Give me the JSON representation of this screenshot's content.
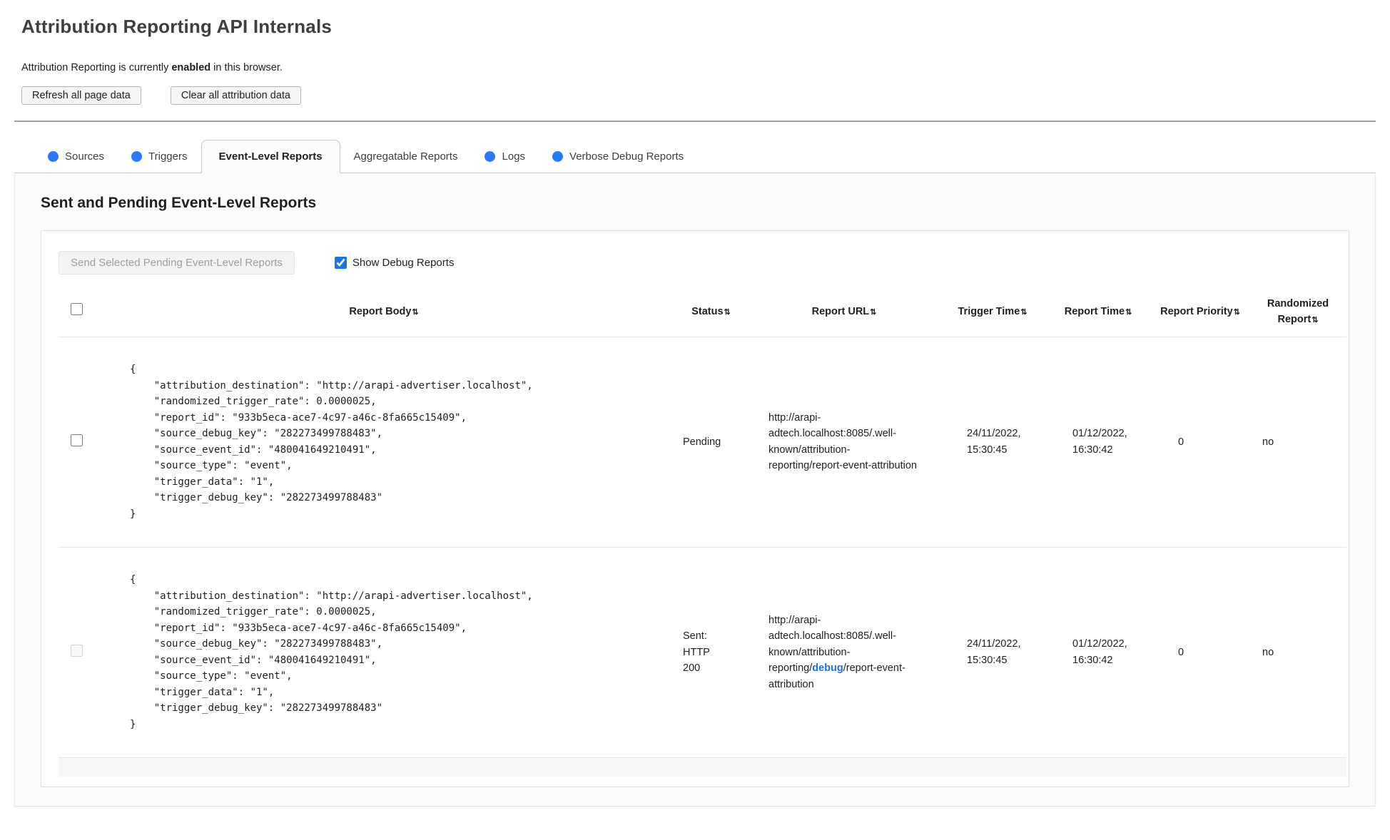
{
  "page": {
    "title": "Attribution Reporting API Internals",
    "status_prefix": "Attribution Reporting is currently ",
    "status_bold": "enabled",
    "status_suffix": " in this browser.",
    "refresh_button": "Refresh all page data",
    "clear_button": "Clear all attribution data"
  },
  "tabs": {
    "sources": "Sources",
    "triggers": "Triggers",
    "event_level": "Event-Level Reports",
    "aggregatable": "Aggregatable Reports",
    "logs": "Logs",
    "verbose": "Verbose Debug Reports"
  },
  "section": {
    "heading": "Sent and Pending Event-Level Reports",
    "send_button": "Send Selected Pending Event-Level Reports",
    "show_debug_label": "Show Debug Reports"
  },
  "table": {
    "sort_icon": "⇅",
    "columns": {
      "report_body": "Report Body",
      "status": "Status",
      "report_url": "Report URL",
      "trigger_time": "Trigger Time",
      "report_time": "Report Time",
      "report_priority": "Report Priority",
      "randomized_report": "Randomized Report"
    },
    "rows": [
      {
        "report_body": "{\n    \"attribution_destination\": \"http://arapi-advertiser.localhost\",\n    \"randomized_trigger_rate\": 0.0000025,\n    \"report_id\": \"933b5eca-ace7-4c97-a46c-8fa665c15409\",\n    \"source_debug_key\": \"282273499788483\",\n    \"source_event_id\": \"480041649210491\",\n    \"source_type\": \"event\",\n    \"trigger_data\": \"1\",\n    \"trigger_debug_key\": \"282273499788483\"\n}",
        "status": "Pending",
        "url_pre": "http://arapi-adtech.localhost:8085/.well-known/attribution-reporting/report-event-attribution",
        "url_link": "",
        "url_post": "",
        "trigger_time": "24/11/2022, 15:30:45",
        "report_time": "01/12/2022, 16:30:42",
        "priority": "0",
        "randomized": "no"
      },
      {
        "report_body": "{\n    \"attribution_destination\": \"http://arapi-advertiser.localhost\",\n    \"randomized_trigger_rate\": 0.0000025,\n    \"report_id\": \"933b5eca-ace7-4c97-a46c-8fa665c15409\",\n    \"source_debug_key\": \"282273499788483\",\n    \"source_event_id\": \"480041649210491\",\n    \"source_type\": \"event\",\n    \"trigger_data\": \"1\",\n    \"trigger_debug_key\": \"282273499788483\"\n}",
        "status": "Sent: HTTP 200",
        "url_pre": "http://arapi-adtech.localhost:8085/.well-known/attribution-reporting/",
        "url_link": "debug",
        "url_post": "/report-event-attribution",
        "trigger_time": "24/11/2022, 15:30:45",
        "report_time": "01/12/2022, 16:30:42",
        "priority": "0",
        "randomized": "no"
      }
    ]
  }
}
